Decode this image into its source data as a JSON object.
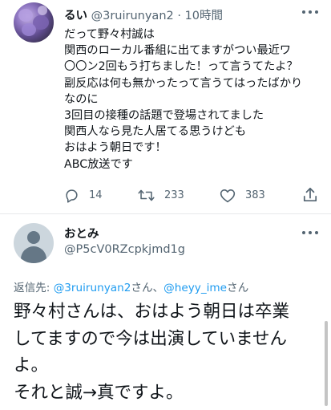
{
  "tweet1": {
    "display_name": "るい",
    "handle": "@3ruirunyan2",
    "separator": "·",
    "time": "10時間",
    "body_lines": [
      "だって野々村誠は",
      "関西のローカル番組に出てますがつい最近ワ",
      "〇〇ン2回もう打ちました！って言うてたよ？",
      "副反応は何も無かったって言うてはったばかり",
      "なのに",
      "3回目の接種の話題で登場されてました",
      "関西人なら見た人居てる思うけども",
      "おはよう朝日です！",
      "ABC放送です"
    ],
    "actions": {
      "reply_count": "14",
      "retweet_count": "233",
      "like_count": "383"
    }
  },
  "tweet2": {
    "display_name": "おとみ",
    "handle": "@P5cV0RZcpkjmd1g",
    "reply_to": {
      "prefix": "返信先: ",
      "mention1": "@3ruirunyan2",
      "san1": "さん、",
      "mention2": "@heyy_ime",
      "san2": "さん"
    },
    "body_lines": [
      "野々村さんは、おはよう朝日は卒業",
      "してますので今は出演していません",
      "よ。",
      "それと誠→真ですよ。"
    ]
  },
  "colors": {
    "text": "#0f1419",
    "secondary": "#536471",
    "link": "#1d9bf0",
    "divider": "#e7e9ea"
  },
  "icons": [
    "more-horizontal-icon",
    "reply-icon",
    "retweet-icon",
    "like-icon",
    "share-icon"
  ]
}
